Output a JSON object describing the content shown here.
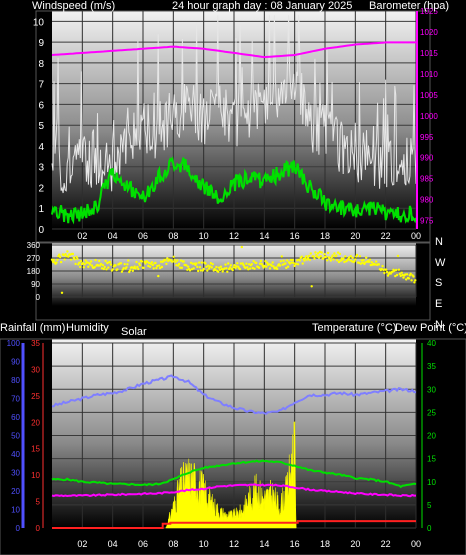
{
  "header": {
    "top_left": "Windspeed (m/s)",
    "top_center": "24 hour graph day : 08 January 2025",
    "top_right": "Barometer (hpa)",
    "mid_left_1": "Rainfall (mm)",
    "mid_left_2": "Humidity",
    "mid_center": "Solar",
    "mid_right_1": "Temperature (°C)",
    "mid_right_2": "Dew Point (°C)"
  },
  "colors": {
    "wind_gust": "#e6e6e6",
    "wind_avg": "#00e000",
    "barometer": "#ff00ff",
    "wind_dir": "#ffff00",
    "humidity": "#7f7fff",
    "rainfall": "#ff2020",
    "temperature": "#00e000",
    "dew_point": "#ff00ff",
    "solar": "#ffff00",
    "rain_axis": "#ff3030",
    "humidity_axis": "#5050ff",
    "temp_axis": "#00e000",
    "baro_axis": "#ff00ff"
  },
  "chart_data": [
    {
      "type": "line",
      "title": "24 hour graph day : 08 January 2025",
      "x_ticks": [
        "02",
        "04",
        "06",
        "08",
        "10",
        "12",
        "14",
        "16",
        "18",
        "20",
        "22",
        "00"
      ],
      "y_left_label": "Windspeed (m/s)",
      "y_left_ticks": [
        "0",
        "1",
        "2",
        "3",
        "4",
        "5",
        "6",
        "7",
        "8",
        "9",
        "10"
      ],
      "ylim_left": [
        0,
        10.5
      ],
      "y_right_label": "Barometer (hpa)",
      "y_right_ticks": [
        "975",
        "980",
        "985",
        "990",
        "995",
        "1000",
        "1005",
        "1010",
        "1015",
        "1020",
        "1025"
      ],
      "ylim_right": [
        973,
        1025
      ],
      "series": [
        {
          "name": "Windspeed (m/s)",
          "role": "gust",
          "axis": "left",
          "x": [
            0,
            1,
            2,
            3,
            4,
            5,
            6,
            7,
            8,
            9,
            10,
            11,
            12,
            13,
            14,
            15,
            16,
            17,
            18,
            19,
            20,
            21,
            22,
            23,
            24
          ],
          "y": [
            3.5,
            3.0,
            3.8,
            3.2,
            3.5,
            4.5,
            5.5,
            4.8,
            6.0,
            6.5,
            5.8,
            6.5,
            5.5,
            6.2,
            6.5,
            7.0,
            8.0,
            5.5,
            5.2,
            4.5,
            4.0,
            4.0,
            3.5,
            3.8,
            3.5
          ]
        },
        {
          "name": "Windspeed (m/s)",
          "role": "average",
          "axis": "left",
          "x": [
            0,
            1,
            2,
            3,
            4,
            5,
            6,
            7,
            8,
            9,
            10,
            11,
            12,
            13,
            14,
            15,
            16,
            17,
            18,
            19,
            20,
            21,
            22,
            23,
            24
          ],
          "y": [
            1.0,
            0.6,
            0.8,
            1.2,
            2.8,
            2.0,
            1.5,
            2.5,
            3.2,
            3.0,
            2.0,
            1.5,
            2.2,
            2.5,
            2.3,
            2.7,
            3.0,
            2.0,
            1.3,
            1.0,
            0.9,
            1.0,
            0.8,
            0.7,
            0.8
          ]
        },
        {
          "name": "Barometer (hpa)",
          "axis": "right",
          "x": [
            0,
            2,
            4,
            6,
            8,
            10,
            12,
            14,
            16,
            18,
            20,
            22,
            24
          ],
          "y": [
            1014.5,
            1015,
            1015.5,
            1016,
            1016.5,
            1016,
            1015,
            1014,
            1014.5,
            1016,
            1017,
            1017.5,
            1017.5
          ]
        }
      ]
    },
    {
      "type": "scatter",
      "x_ticks": [
        "02",
        "04",
        "06",
        "08",
        "10",
        "12",
        "14",
        "16",
        "18",
        "20",
        "22",
        "00"
      ],
      "y_ticks": [
        "0",
        "90",
        "180",
        "270",
        "360"
      ],
      "ylim": [
        0,
        360
      ],
      "compass": [
        "N",
        "W",
        "S",
        "E",
        "N"
      ],
      "series": [
        {
          "name": "Wind direction",
          "x": [
            0,
            1,
            2,
            3,
            4,
            5,
            6,
            7,
            8,
            9,
            10,
            11,
            12,
            13,
            14,
            15,
            16,
            17,
            18,
            19,
            20,
            21,
            22,
            23,
            24
          ],
          "y": [
            230,
            300,
            220,
            230,
            210,
            200,
            230,
            220,
            250,
            210,
            210,
            200,
            205,
            215,
            225,
            215,
            240,
            280,
            285,
            270,
            265,
            250,
            170,
            160,
            120
          ]
        }
      ]
    },
    {
      "type": "line",
      "x_ticks": [
        "02",
        "04",
        "06",
        "08",
        "10",
        "12",
        "14",
        "16",
        "18",
        "20",
        "22",
        "00"
      ],
      "y_rain_label": "Rainfall (mm)",
      "y_rain_ticks": [
        "0",
        "5",
        "10",
        "15",
        "20",
        "25",
        "30",
        "35"
      ],
      "ylim_rain": [
        0,
        35
      ],
      "y_humidity_label": "Humidity",
      "y_humidity_ticks": [
        "0",
        "10",
        "20",
        "30",
        "40",
        "50",
        "60",
        "70",
        "80",
        "90",
        "100"
      ],
      "ylim_humidity": [
        0,
        100
      ],
      "y_temp_label": "Temperature (°C)",
      "y_temp_ticks": [
        "0",
        "5",
        "10",
        "15",
        "20",
        "25",
        "30",
        "35",
        "40"
      ],
      "ylim_temp": [
        0,
        40
      ],
      "series": [
        {
          "name": "Humidity",
          "axis": "humidity",
          "x": [
            0,
            1,
            2,
            3,
            4,
            5,
            6,
            7,
            8,
            9,
            10,
            11,
            12,
            13,
            14,
            15,
            16,
            17,
            18,
            19,
            20,
            21,
            22,
            23,
            24
          ],
          "y": [
            66,
            68,
            70,
            72,
            73,
            75,
            78,
            80,
            82,
            79,
            72,
            68,
            65,
            63,
            62,
            63,
            68,
            72,
            72,
            73,
            72,
            73,
            74,
            75,
            74
          ]
        },
        {
          "name": "Temperature (°C)",
          "axis": "temp",
          "x": [
            0,
            1,
            2,
            3,
            4,
            5,
            6,
            7,
            8,
            9,
            10,
            11,
            12,
            13,
            14,
            15,
            16,
            17,
            18,
            19,
            20,
            21,
            22,
            23,
            24
          ],
          "y": [
            10.5,
            10.5,
            10.0,
            9.8,
            9.5,
            9.5,
            9.3,
            9.5,
            10.5,
            12.0,
            13.0,
            13.5,
            14.0,
            14.3,
            14.5,
            14.2,
            13.5,
            12.5,
            12.0,
            11.5,
            10.8,
            10.5,
            10.0,
            9.0,
            9.5
          ]
        },
        {
          "name": "Dew Point (°C)",
          "axis": "temp",
          "x": [
            0,
            1,
            2,
            3,
            4,
            5,
            6,
            7,
            8,
            9,
            10,
            11,
            12,
            13,
            14,
            15,
            16,
            17,
            18,
            19,
            20,
            21,
            22,
            23,
            24
          ],
          "y": [
            7.0,
            7.0,
            7.0,
            7.1,
            7.2,
            7.3,
            7.4,
            7.5,
            7.8,
            8.2,
            8.5,
            9.0,
            9.2,
            9.3,
            9.3,
            9.2,
            8.8,
            8.3,
            8.0,
            7.8,
            7.5,
            7.3,
            7.2,
            7.0,
            7.0
          ]
        },
        {
          "name": "Rainfall (mm)",
          "axis": "rain",
          "x": [
            0,
            6.8,
            7.3,
            7.8,
            16.0,
            16.2,
            24
          ],
          "y": [
            0.0,
            0.0,
            0.8,
            1.0,
            1.0,
            1.3,
            1.3
          ]
        },
        {
          "name": "Solar",
          "axis": "temp",
          "fill": true,
          "x": [
            7.5,
            8,
            8.5,
            9,
            9.5,
            10,
            10.5,
            11,
            11.5,
            12,
            12.5,
            13,
            13.5,
            14,
            14.5,
            15,
            15.5,
            16,
            16.1
          ],
          "y": [
            0,
            5,
            10,
            12,
            11,
            9,
            6,
            4,
            3,
            3,
            4,
            7,
            9,
            7,
            8,
            5,
            9,
            20,
            0
          ]
        }
      ]
    }
  ]
}
